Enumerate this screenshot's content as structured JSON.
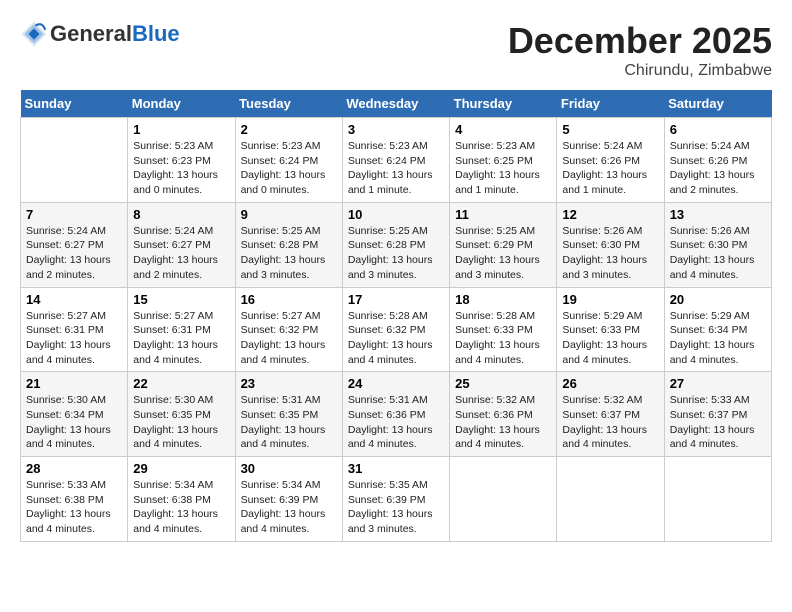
{
  "header": {
    "logo_general": "General",
    "logo_blue": "Blue",
    "month_title": "December 2025",
    "location": "Chirundu, Zimbabwe"
  },
  "days_of_week": [
    "Sunday",
    "Monday",
    "Tuesday",
    "Wednesday",
    "Thursday",
    "Friday",
    "Saturday"
  ],
  "weeks": [
    [
      {
        "day": "",
        "info": ""
      },
      {
        "day": "1",
        "info": "Sunrise: 5:23 AM\nSunset: 6:23 PM\nDaylight: 13 hours\nand 0 minutes."
      },
      {
        "day": "2",
        "info": "Sunrise: 5:23 AM\nSunset: 6:24 PM\nDaylight: 13 hours\nand 0 minutes."
      },
      {
        "day": "3",
        "info": "Sunrise: 5:23 AM\nSunset: 6:24 PM\nDaylight: 13 hours\nand 1 minute."
      },
      {
        "day": "4",
        "info": "Sunrise: 5:23 AM\nSunset: 6:25 PM\nDaylight: 13 hours\nand 1 minute."
      },
      {
        "day": "5",
        "info": "Sunrise: 5:24 AM\nSunset: 6:26 PM\nDaylight: 13 hours\nand 1 minute."
      },
      {
        "day": "6",
        "info": "Sunrise: 5:24 AM\nSunset: 6:26 PM\nDaylight: 13 hours\nand 2 minutes."
      }
    ],
    [
      {
        "day": "7",
        "info": "Sunrise: 5:24 AM\nSunset: 6:27 PM\nDaylight: 13 hours\nand 2 minutes."
      },
      {
        "day": "8",
        "info": "Sunrise: 5:24 AM\nSunset: 6:27 PM\nDaylight: 13 hours\nand 2 minutes."
      },
      {
        "day": "9",
        "info": "Sunrise: 5:25 AM\nSunset: 6:28 PM\nDaylight: 13 hours\nand 3 minutes."
      },
      {
        "day": "10",
        "info": "Sunrise: 5:25 AM\nSunset: 6:28 PM\nDaylight: 13 hours\nand 3 minutes."
      },
      {
        "day": "11",
        "info": "Sunrise: 5:25 AM\nSunset: 6:29 PM\nDaylight: 13 hours\nand 3 minutes."
      },
      {
        "day": "12",
        "info": "Sunrise: 5:26 AM\nSunset: 6:30 PM\nDaylight: 13 hours\nand 3 minutes."
      },
      {
        "day": "13",
        "info": "Sunrise: 5:26 AM\nSunset: 6:30 PM\nDaylight: 13 hours\nand 4 minutes."
      }
    ],
    [
      {
        "day": "14",
        "info": "Sunrise: 5:27 AM\nSunset: 6:31 PM\nDaylight: 13 hours\nand 4 minutes."
      },
      {
        "day": "15",
        "info": "Sunrise: 5:27 AM\nSunset: 6:31 PM\nDaylight: 13 hours\nand 4 minutes."
      },
      {
        "day": "16",
        "info": "Sunrise: 5:27 AM\nSunset: 6:32 PM\nDaylight: 13 hours\nand 4 minutes."
      },
      {
        "day": "17",
        "info": "Sunrise: 5:28 AM\nSunset: 6:32 PM\nDaylight: 13 hours\nand 4 minutes."
      },
      {
        "day": "18",
        "info": "Sunrise: 5:28 AM\nSunset: 6:33 PM\nDaylight: 13 hours\nand 4 minutes."
      },
      {
        "day": "19",
        "info": "Sunrise: 5:29 AM\nSunset: 6:33 PM\nDaylight: 13 hours\nand 4 minutes."
      },
      {
        "day": "20",
        "info": "Sunrise: 5:29 AM\nSunset: 6:34 PM\nDaylight: 13 hours\nand 4 minutes."
      }
    ],
    [
      {
        "day": "21",
        "info": "Sunrise: 5:30 AM\nSunset: 6:34 PM\nDaylight: 13 hours\nand 4 minutes."
      },
      {
        "day": "22",
        "info": "Sunrise: 5:30 AM\nSunset: 6:35 PM\nDaylight: 13 hours\nand 4 minutes."
      },
      {
        "day": "23",
        "info": "Sunrise: 5:31 AM\nSunset: 6:35 PM\nDaylight: 13 hours\nand 4 minutes."
      },
      {
        "day": "24",
        "info": "Sunrise: 5:31 AM\nSunset: 6:36 PM\nDaylight: 13 hours\nand 4 minutes."
      },
      {
        "day": "25",
        "info": "Sunrise: 5:32 AM\nSunset: 6:36 PM\nDaylight: 13 hours\nand 4 minutes."
      },
      {
        "day": "26",
        "info": "Sunrise: 5:32 AM\nSunset: 6:37 PM\nDaylight: 13 hours\nand 4 minutes."
      },
      {
        "day": "27",
        "info": "Sunrise: 5:33 AM\nSunset: 6:37 PM\nDaylight: 13 hours\nand 4 minutes."
      }
    ],
    [
      {
        "day": "28",
        "info": "Sunrise: 5:33 AM\nSunset: 6:38 PM\nDaylight: 13 hours\nand 4 minutes."
      },
      {
        "day": "29",
        "info": "Sunrise: 5:34 AM\nSunset: 6:38 PM\nDaylight: 13 hours\nand 4 minutes."
      },
      {
        "day": "30",
        "info": "Sunrise: 5:34 AM\nSunset: 6:39 PM\nDaylight: 13 hours\nand 4 minutes."
      },
      {
        "day": "31",
        "info": "Sunrise: 5:35 AM\nSunset: 6:39 PM\nDaylight: 13 hours\nand 3 minutes."
      },
      {
        "day": "",
        "info": ""
      },
      {
        "day": "",
        "info": ""
      },
      {
        "day": "",
        "info": ""
      }
    ]
  ]
}
